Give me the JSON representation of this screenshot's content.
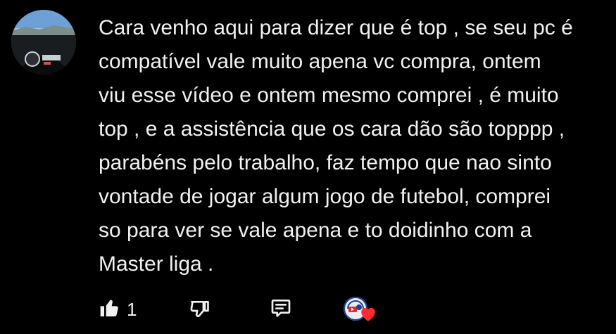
{
  "comment": {
    "text": "Cara venho aqui para dizer que  é top , se seu pc é\ncompatível vale muito apena vc compra,  ontem\nviu esse vídeo e ontem mesmo comprei , é muito\ntop , e a assistência que os cara dão são topppp ,\nparabéns pelo trabalho,  faz tempo que nao sinto\nvontade de jogar algum jogo de futebol,  comprei\nso para ver se vale apena e to doidinho com a\nMaster liga ."
  },
  "actions": {
    "like_count": "1",
    "like_icon": "thumbs-up-icon",
    "dislike_icon": "thumbs-down-icon",
    "reply_icon": "reply-icon",
    "creator_heart_icon": "heart-icon"
  },
  "colors": {
    "background": "#000000",
    "text": "#f1f1f1",
    "heart": "#ff2c2c"
  }
}
